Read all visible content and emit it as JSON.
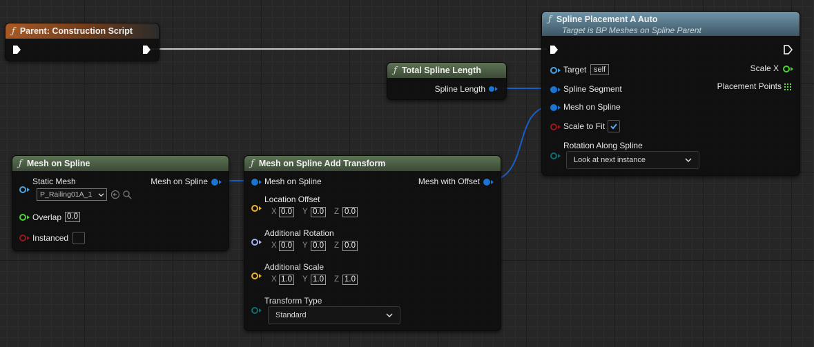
{
  "colors": {
    "object_pin": "#1a74d4",
    "float_pin": "#4bd233",
    "bool_pin": "#a0141c",
    "vector_pin": "#f0b225",
    "rotator_pin": "#a3b3f5",
    "enum_pin": "#0e6d6d",
    "exec_pin": "#ffffff",
    "wire_blue": "#1a5ec8",
    "wire_exec": "#ffffff"
  },
  "nodes": {
    "construction": {
      "icon": "function-icon",
      "title": "Parent: Construction Script"
    },
    "total_spline": {
      "icon": "function-icon",
      "title": "Total Spline Length",
      "output_label": "Spline Length"
    },
    "spline_placement": {
      "icon": "function-icon",
      "title": "Spline Placement A Auto",
      "subtitle": "Target is BP Meshes on Spline Parent",
      "target_label": "Target",
      "target_value": "self",
      "spline_segment_label": "Spline Segment",
      "mesh_on_spline_label": "Mesh on Spline",
      "scale_to_fit_label": "Scale to Fit",
      "scale_to_fit_checked": true,
      "rotation_label": "Rotation Along Spline",
      "rotation_value": "Look at next instance",
      "scale_x_label": "Scale X",
      "placement_points_label": "Placement Points"
    },
    "mesh_on_spline": {
      "icon": "function-icon",
      "title": "Mesh on Spline",
      "static_mesh_label": "Static Mesh",
      "static_mesh_value": "P_Railing01A_1",
      "overlap_label": "Overlap",
      "overlap_value": "0.0",
      "instanced_label": "Instanced",
      "instanced_checked": false,
      "output_label": "Mesh on Spline"
    },
    "add_transform": {
      "icon": "function-icon",
      "title": "Mesh on Spline Add Transform",
      "input_label": "Mesh on Spline",
      "output_label": "Mesh with Offset",
      "location_label": "Location Offset",
      "location": {
        "x": "0.0",
        "y": "0.0",
        "z": "0.0"
      },
      "rotation_label": "Additional Rotation",
      "rotation": {
        "x": "0.0",
        "y": "0.0",
        "z": "0.0"
      },
      "scale_label": "Additional Scale",
      "scale": {
        "x": "1.0",
        "y": "1.0",
        "z": "1.0"
      },
      "transform_type_label": "Transform Type",
      "transform_type_value": "Standard"
    }
  },
  "axes": {
    "x": "X",
    "y": "Y",
    "z": "Z"
  }
}
